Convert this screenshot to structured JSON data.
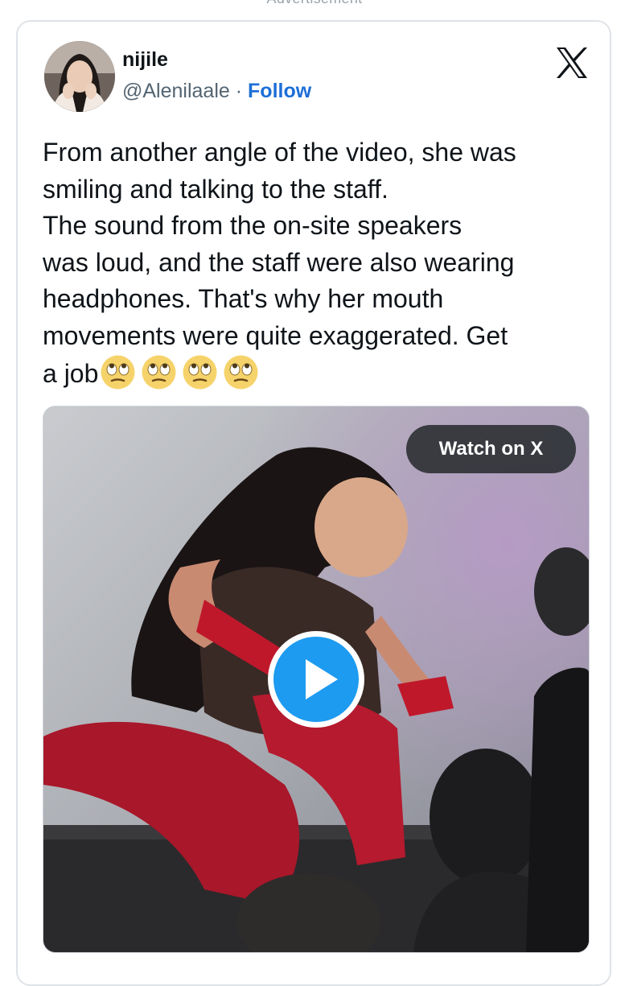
{
  "ad_label": "Advertisement",
  "tweet": {
    "user": {
      "name": "nijile",
      "handle": "@Alenilaale",
      "separator": "·",
      "follow_label": "Follow"
    },
    "text_lines": [
      "From another angle of the video, she was",
      "smiling and talking to the staff.",
      "The sound from the on-site speakers",
      "was loud, and the staff were also wearing",
      "headphones. That's why her mouth",
      "movements were quite exaggerated. Get",
      "a job"
    ],
    "emojis": [
      "🙄",
      "🙄",
      "🙄",
      "🙄"
    ],
    "media": {
      "watch_label": "Watch on X",
      "play_icon": "play-icon"
    }
  },
  "icons": {
    "brand_logo": "x-logo-icon"
  },
  "colors": {
    "text": "#0f1419",
    "secondary_text": "#536471",
    "follow": "#1d6fd6",
    "play_button": "#1d9bf0",
    "card_border": "#dfe3e7"
  }
}
